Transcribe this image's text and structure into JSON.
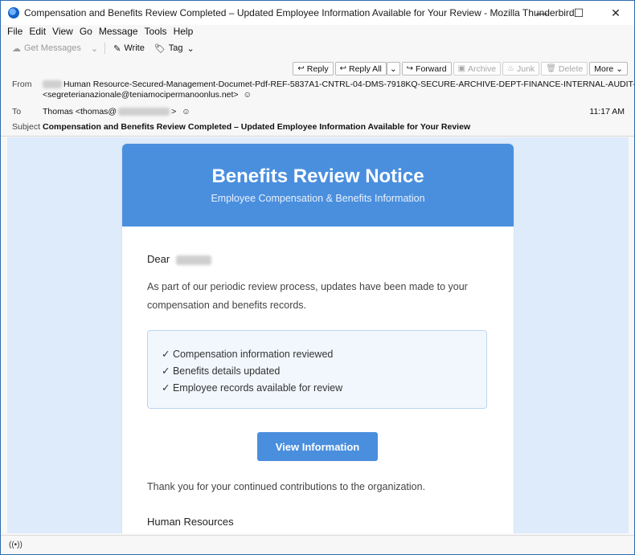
{
  "window": {
    "title": "Compensation and Benefits Review Completed – Updated Employee Information Available for Your Review - Mozilla Thunderbird",
    "controls": {
      "minimize": "—",
      "maximize": "☐",
      "close": "✕"
    }
  },
  "menu": {
    "items": [
      "File",
      "Edit",
      "View",
      "Go",
      "Message",
      "Tools",
      "Help"
    ]
  },
  "toolbar": {
    "get_messages": "Get Messages",
    "write": "Write",
    "tag": "Tag"
  },
  "header": {
    "buttons": {
      "reply": "Reply",
      "reply_all": "Reply All",
      "forward": "Forward",
      "archive": "Archive",
      "junk": "Junk",
      "delete": "Delete",
      "more": "More"
    },
    "from_label": "From",
    "from_name": "Human Resource-Secured-Management-Documet-Pdf-REF-5837A1-CNTRL-04-DMS-7918KQ-SECURE-ARCHIVE-DEPT-FINANCE-INTERNAL-AUDIT-COMPLIANCE",
    "from_address": "<segreterianazionale@teniamocipermanoonlus.net>",
    "to_label": "To",
    "to_name": "Thomas <thomas@",
    "to_end": ">",
    "time": "11:17 AM",
    "subject_label": "Subject",
    "subject": "Compensation and Benefits Review Completed – Updated Employee Information Available for Your Review"
  },
  "email": {
    "banner_title": "Benefits Review Notice",
    "banner_subtitle": "Employee Compensation & Benefits Information",
    "greeting": "Dear",
    "paragraph": "As part of our periodic review process, updates have been made to your compensation and benefits records.",
    "checklist": [
      "✓ Compensation information reviewed",
      "✓ Benefits details updated",
      "✓ Employee records available for review"
    ],
    "cta": "View Information",
    "thanks": "Thank you for your continued contributions to the organization.",
    "signoff": "Human Resources"
  },
  "colors": {
    "accent": "#4a8fde",
    "body_bg": "#deebfb",
    "infobox_bg": "#f2f7fd",
    "infobox_border": "#bcd5f0"
  }
}
